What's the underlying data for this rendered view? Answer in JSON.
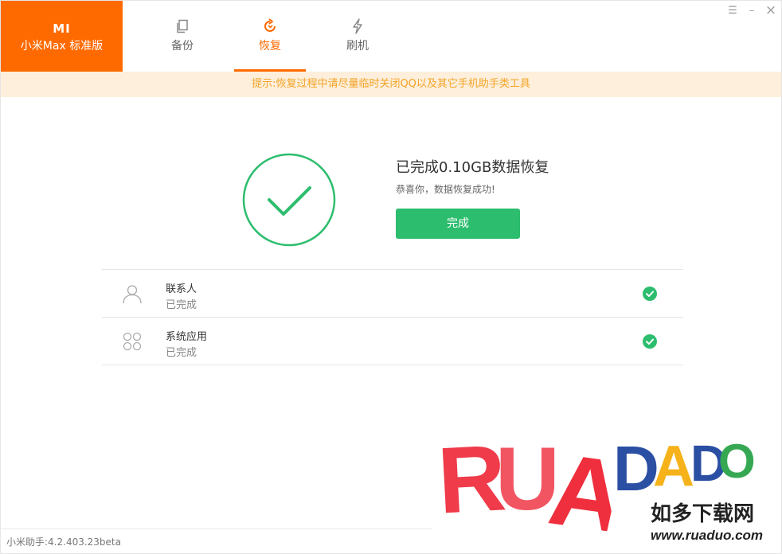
{
  "brand": {
    "logo": "MI",
    "name": "小米Max 标准版"
  },
  "tabs": [
    {
      "label": "备份",
      "icon": "copy-icon"
    },
    {
      "label": "恢复",
      "icon": "restore-icon",
      "active": true
    },
    {
      "label": "刷机",
      "icon": "flash-icon"
    }
  ],
  "window_controls": {
    "menu": "☰",
    "minimize": "–",
    "close": "×"
  },
  "notice": "提示:恢复过程中请尽量临时关闭QQ以及其它手机助手类工具",
  "result": {
    "title": "已完成0.10GB数据恢复",
    "subtitle": "恭喜你，数据恢复成功!",
    "button": "完成"
  },
  "items": [
    {
      "name": "联系人",
      "status": "已完成",
      "icon": "person-icon"
    },
    {
      "name": "系统应用",
      "status": "已完成",
      "icon": "apps-icon"
    }
  ],
  "footer": {
    "version": "小米助手:4.2.403.23beta"
  },
  "watermark": {
    "brand": "RUADADO",
    "chinese": "如多下载网",
    "url": "www.ruaduo.com"
  },
  "colors": {
    "accent": "#ff6a00",
    "success": "#2dbd6e",
    "notice_bg": "#fdefdb",
    "notice_text": "#f4a326"
  }
}
